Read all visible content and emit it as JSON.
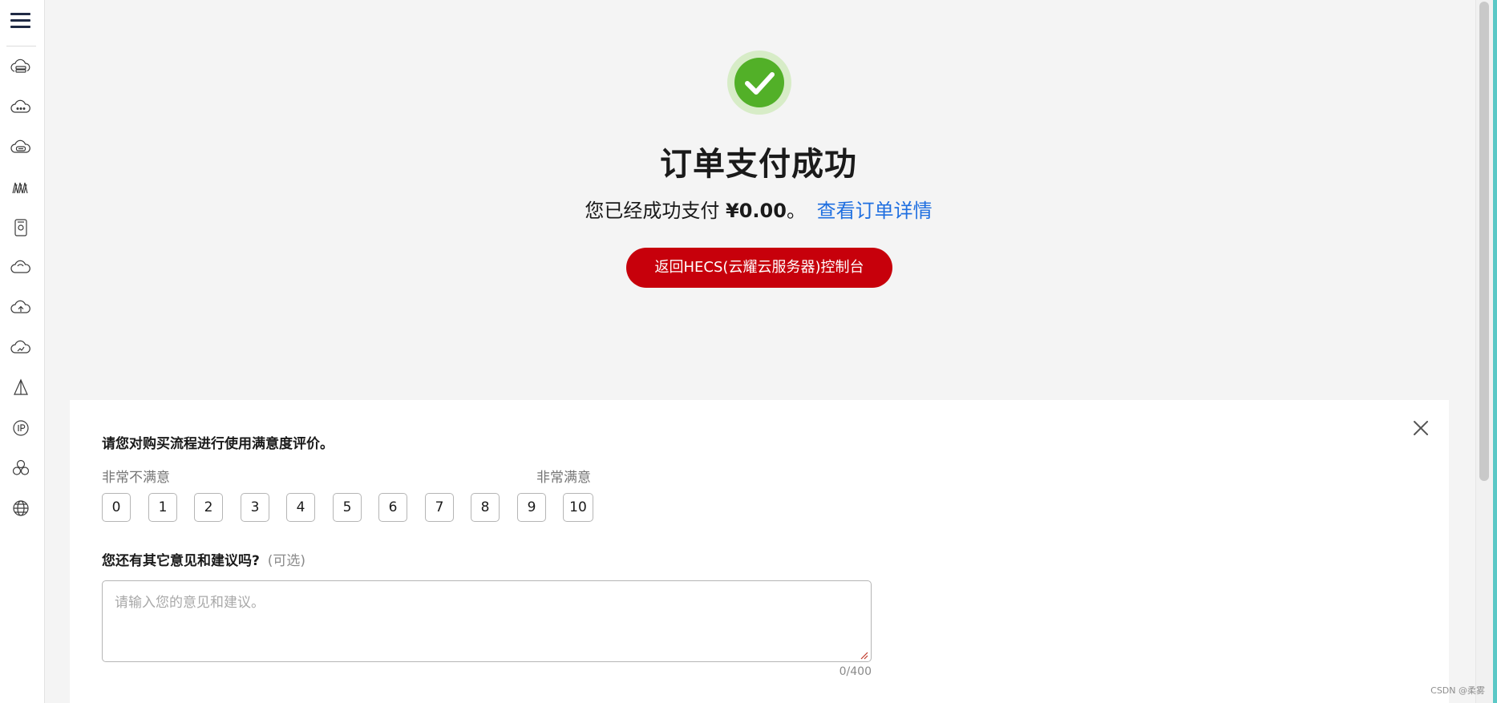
{
  "sidebar": {
    "icons": [
      "cloud-server-icon",
      "cloud-service-icon",
      "cloud-database-icon",
      "network-icon",
      "storage-device-icon",
      "cloud-icon",
      "cloud-upload-icon",
      "cloud-monitor-icon",
      "tent-icon",
      "ip-address-icon",
      "cluster-icon",
      "globe-icon"
    ]
  },
  "header": {
    "title": "订单支付成功",
    "pay_prefix": "您已经成功支付",
    "amount": "¥0.00",
    "period": "。",
    "detail_link": "查看订单详情",
    "console_button": "返回HECS(云耀云服务器)控制台"
  },
  "survey": {
    "question": "请您对购买流程进行使用满意度评价。",
    "scale_low": "非常不满意",
    "scale_high": "非常满意",
    "ratings": [
      "0",
      "1",
      "2",
      "3",
      "4",
      "5",
      "6",
      "7",
      "8",
      "9",
      "10"
    ],
    "feedback_question": "您还有其它意见和建议吗?",
    "optional": "(可选)",
    "placeholder": "请输入您的意见和建议。",
    "char_count": "0/400"
  },
  "watermark": "CSDN @柔雾",
  "colors": {
    "primary_red": "#c7000b",
    "success_green": "#52b028",
    "link_blue": "#1f6fe0",
    "accent_teal": "#5bc8c6"
  }
}
